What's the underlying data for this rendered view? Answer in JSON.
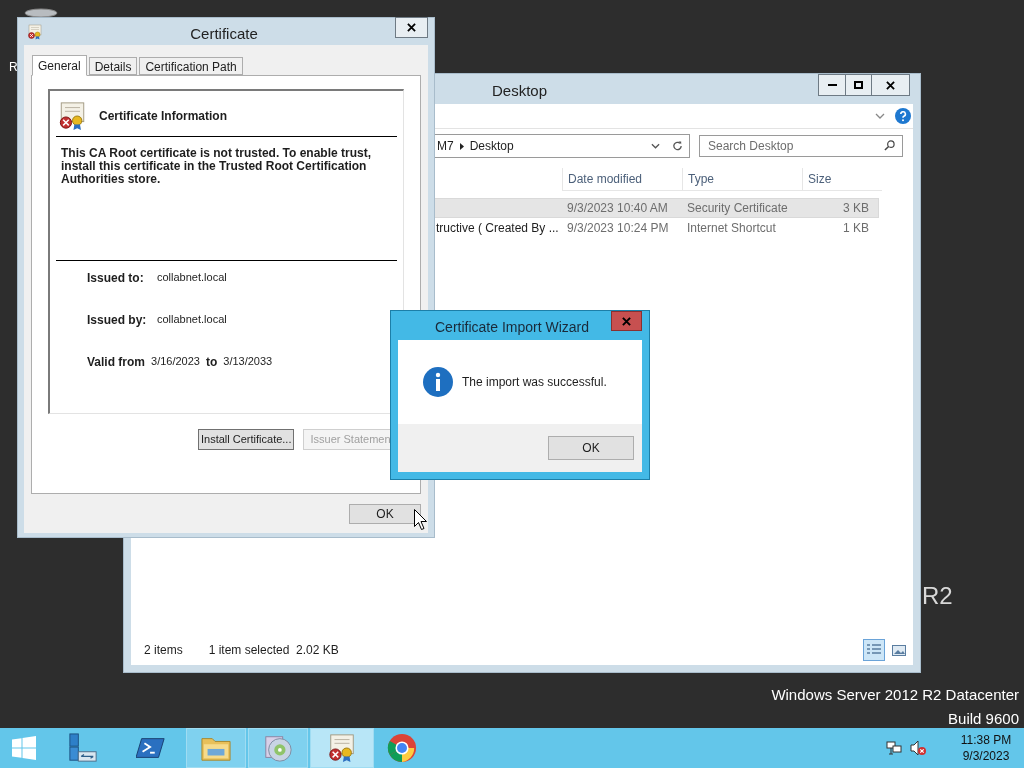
{
  "desktop": {
    "icon_label": "R",
    "logo_fragment": "R2",
    "edition": "Windows Server 2012 R2 Datacenter",
    "build": "Build 9600"
  },
  "explorer": {
    "title": "Desktop",
    "breadcrumb": [
      "M7",
      "Desktop"
    ],
    "search": {
      "placeholder": "Search Desktop"
    },
    "columns": [
      "Date modified",
      "Type",
      "Size"
    ],
    "rows": [
      {
        "date": "9/3/2023 10:40 AM",
        "type": "Security Certificate",
        "size": "3 KB",
        "selected": true
      },
      {
        "name": "tructive ( Created By ...",
        "date": "9/3/2023 10:24 PM",
        "type": "Internet Shortcut",
        "size": "1 KB",
        "selected": false
      }
    ],
    "status": {
      "count": "2 items",
      "selection": "1 item selected  2.02 KB"
    },
    "views": [
      {
        "kind": "details",
        "selected": true
      },
      {
        "kind": "preview",
        "selected": false
      }
    ]
  },
  "certificate": {
    "title": "Certificate",
    "tabs": [
      {
        "label": "General",
        "selected": true
      },
      {
        "label": "Details",
        "selected": false
      },
      {
        "label": "Certification Path",
        "selected": false
      }
    ],
    "heading": "Certificate Information",
    "message": "This CA Root certificate is not trusted. To enable trust, install this certificate in the Trusted Root Certification Authorities store.",
    "fields": [
      {
        "label": "Issued to:",
        "value": "collabnet.local"
      },
      {
        "label": "Issued by:",
        "value": "collabnet.local"
      }
    ],
    "validity": {
      "label": "Valid from",
      "from": "3/16/2023",
      "connector": "to",
      "to": "3/13/2033"
    },
    "buttons": [
      {
        "label": "Install Certificate...",
        "disabled": false
      },
      {
        "label": "Issuer Statemen",
        "disabled": true
      }
    ],
    "ok": "OK"
  },
  "wizard": {
    "title": "Certificate Import Wizard",
    "message": "The import was successful.",
    "button": "OK"
  },
  "taskbar": {
    "apps": [
      {
        "kind": "start",
        "running": false,
        "selected": false
      },
      {
        "kind": "server",
        "running": false,
        "selected": false
      },
      {
        "kind": "shell",
        "running": false,
        "selected": false
      },
      {
        "kind": "folder",
        "running": true,
        "selected": false
      },
      {
        "kind": "disc",
        "running": true,
        "selected": false
      },
      {
        "kind": "certificate",
        "running": true,
        "selected": true
      },
      {
        "kind": "browser",
        "running": false,
        "selected": false
      }
    ],
    "clock": {
      "time": "11:38 PM",
      "date": "9/3/2023"
    }
  }
}
